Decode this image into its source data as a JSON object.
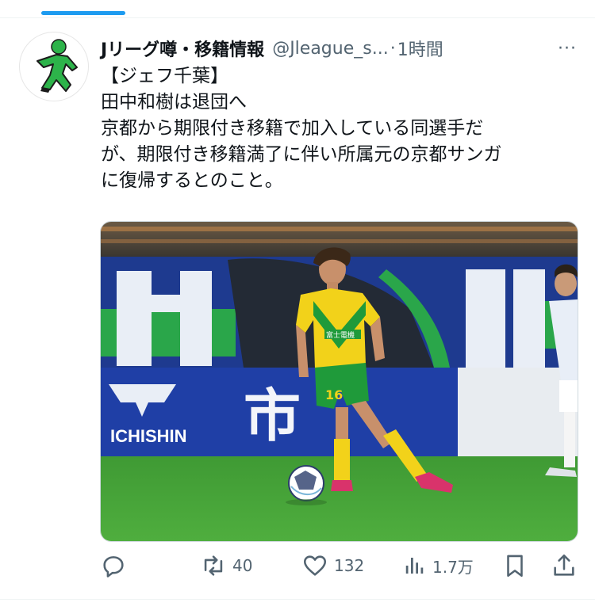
{
  "tweet": {
    "display_name": "Jリーグ噂・移籍情報",
    "handle": "@Jleague_s...",
    "separator": "·",
    "time": "1時間",
    "more_label": "···",
    "text_lines": [
      "【ジェフ千葉】",
      "田中和樹は退団へ",
      "京都から期限付き移籍で加入している同選手だ",
      "が、期限付き移籍満了に伴い所属元の京都サンガ",
      "に復帰するとのこと。"
    ]
  },
  "media": {
    "stadium_banner_text": "ICHISHIN",
    "banner_kanji": "市",
    "jersey_number": "16",
    "sponsor_text": "富士電機"
  },
  "actions": {
    "reply_count": "",
    "retweet_count": "40",
    "like_count": "132",
    "views_count": "1.7万"
  },
  "colors": {
    "accent": "#1d9bf0",
    "muted": "#536471",
    "jersey_yellow": "#f2d21a",
    "jersey_green": "#1f9a3a",
    "pitch": "#3f9a34",
    "banner_blue": "#1f3fa6"
  }
}
